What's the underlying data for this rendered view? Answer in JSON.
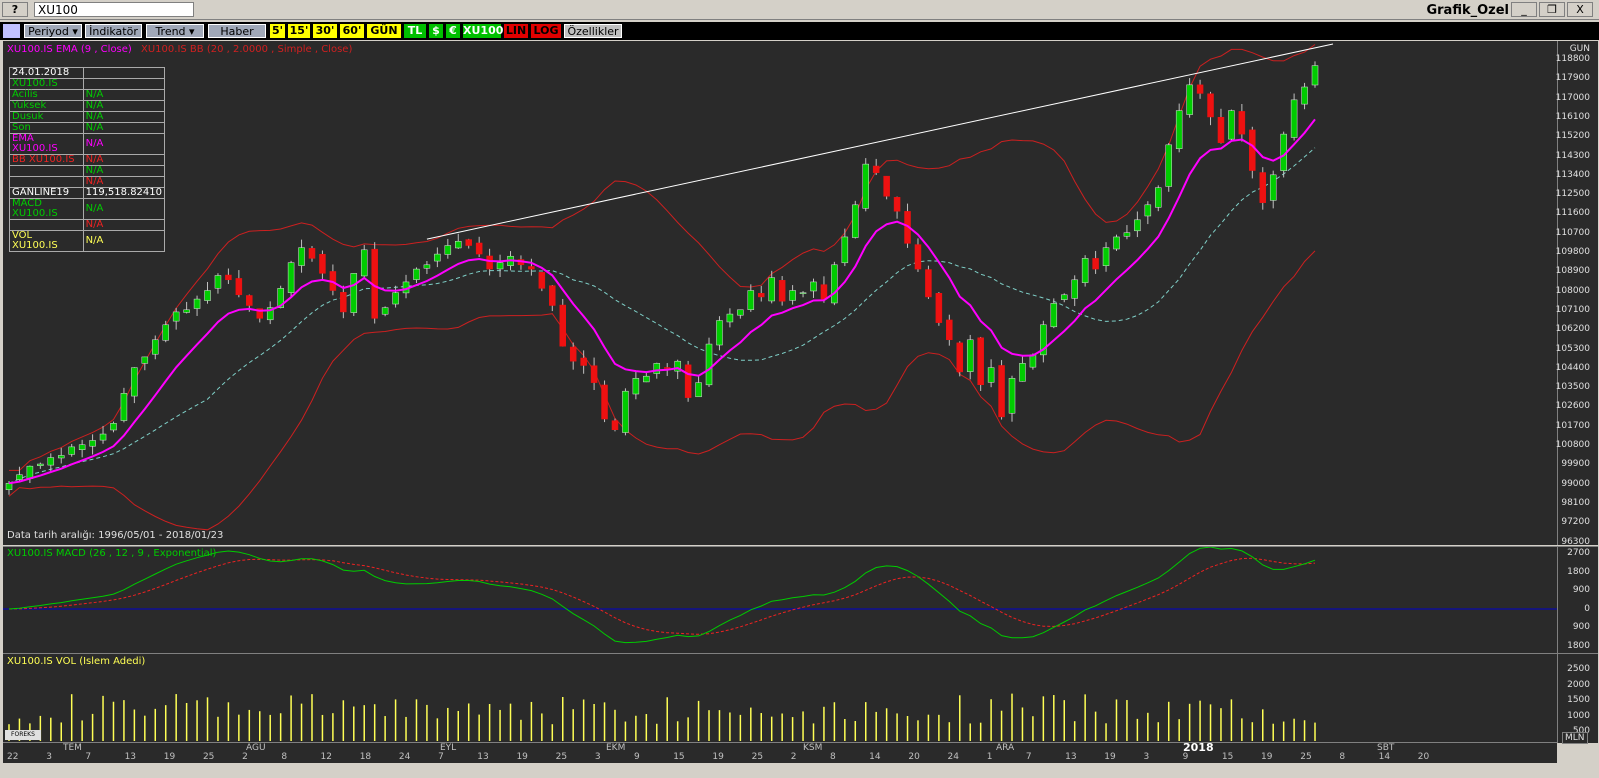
{
  "window": {
    "help": "?",
    "title": "XU100",
    "app_title": "Grafik_Ozel",
    "minimize": "_",
    "restore": "❐",
    "close": "X"
  },
  "toolbar": {
    "periyod": "Periyod ▾",
    "indikator": "İndikatör ▾",
    "trend": "Trend ▾",
    "haber": "Haber",
    "p5": "5'",
    "p15": "15'",
    "p30": "30'",
    "p60": "60'",
    "gun": "GÜN",
    "tl": "TL",
    "usd": "$",
    "eur": "€",
    "symbol": "XU100",
    "lin": "LIN",
    "log": "LOG",
    "ozellikler": "Özellikler"
  },
  "colors": {
    "bg": "#2a2a2a",
    "up": "#00cc00",
    "down": "#ee1111",
    "ema": "#ff00ff",
    "bb": "#cc2020",
    "dash": "#7fd0c8",
    "macd": "#00cc00",
    "signal": "#ee2222",
    "zero": "#0000cc",
    "vol": "#ffff55"
  },
  "main": {
    "legend_ema": "XU100.IS EMA (9 , Close)",
    "legend_bb": "XU100.IS BB (20 , 2.0000 , Simple , Close)",
    "period_label": "GUN",
    "date_range": "Data tarih aralığı: 1996/05/01 - 2018/01/23",
    "yticks": [
      "118800",
      "117900",
      "117000",
      "116100",
      "115200",
      "114300",
      "113400",
      "112500",
      "111600",
      "110700",
      "109800",
      "108900",
      "108000",
      "107100",
      "106200",
      "105300",
      "104400",
      "103500",
      "102600",
      "101700",
      "100800",
      "99900",
      "99000",
      "98100",
      "97200",
      "96300"
    ]
  },
  "info_table": [
    [
      "24.01.2018",
      ""
    ],
    [
      "XU100.IS",
      ""
    ],
    [
      "Acilis",
      "N/A"
    ],
    [
      "Yuksek",
      "N/A"
    ],
    [
      "Dusuk",
      "N/A"
    ],
    [
      "Son",
      "N/A"
    ],
    [
      "EMA XU100.IS",
      "N/A"
    ],
    [
      "BB XU100.IS",
      "N/A"
    ],
    [
      "",
      "N/A"
    ],
    [
      "",
      "N/A"
    ],
    [
      "GANLINE19",
      "119,518.82410"
    ],
    [
      "MACD XU100.IS",
      "N/A"
    ],
    [
      "",
      "N/A"
    ],
    [
      "VOL XU100.IS",
      "N/A"
    ]
  ],
  "macd": {
    "legend": "XU100.IS MACD (26 , 12 , 9 , Exponential)",
    "yticks": [
      "2700",
      "1800",
      "900",
      "0",
      "900",
      "1800"
    ]
  },
  "vol": {
    "legend": "XU100.IS VOL (Islem Adedi)",
    "yticks": [
      "2500",
      "2000",
      "1500",
      "1000",
      "500"
    ],
    "unit": "MLN",
    "logo": "FOREKS"
  },
  "xaxis": {
    "months": [
      "TEM",
      "AGU",
      "EYL",
      "EKM",
      "KSM",
      "ARA",
      "2018",
      "SBT"
    ],
    "days": [
      "22",
      "3",
      "7",
      "13",
      "19",
      "25",
      "2",
      "8",
      "12",
      "18",
      "24",
      "7",
      "13",
      "19",
      "25",
      "3",
      "9",
      "15",
      "19",
      "25",
      "2",
      "8",
      "14",
      "20",
      "24",
      "1",
      "7",
      "13",
      "19",
      "3",
      "9",
      "15",
      "19",
      "25",
      "8",
      "14",
      "20"
    ]
  },
  "chart_data": {
    "type": "candlestick",
    "title": "XU100",
    "ylim": [
      96300,
      118800
    ],
    "candles_close": [
      98900,
      99300,
      99700,
      99800,
      100100,
      100200,
      100600,
      100700,
      100900,
      101200,
      101700,
      103100,
      104300,
      104800,
      105600,
      106300,
      106900,
      107000,
      107500,
      107900,
      108600,
      108400,
      107700,
      107200,
      106600,
      107100,
      108000,
      109200,
      109900,
      109400,
      108700,
      107900,
      106900,
      108700,
      109800,
      106600,
      107100,
      107800,
      108300,
      108900,
      109100,
      109600,
      110000,
      110200,
      110000,
      109600,
      108900,
      109200,
      109500,
      109100,
      108900,
      108000,
      107200,
      105300,
      104600,
      104400,
      103600,
      101900,
      101400,
      103200,
      103800,
      103900,
      104500,
      104300,
      104600,
      102900,
      103600,
      105400,
      106500,
      106800,
      107000,
      107900,
      107600,
      108500,
      107400,
      107900,
      107800,
      108300,
      107500,
      109100,
      110400,
      111900,
      113800,
      113400,
      112300,
      111600,
      110100,
      108900,
      107600,
      106400,
      105600,
      104100,
      105600,
      103500,
      104300,
      102000,
      103800,
      104500,
      104900,
      106300,
      107300,
      107700,
      108400,
      109400,
      108900,
      109900,
      110400,
      110600,
      111200,
      111900,
      112700,
      114700,
      116300,
      117500,
      117100,
      116000,
      114800,
      116300,
      115200,
      113500,
      112000,
      113300,
      115200,
      116800,
      117400,
      118400
    ],
    "ema9_last": 115800,
    "bb_upper_last": 118700,
    "bb_lower_last": 111700,
    "macd_last": 1750,
    "signal_last": 1650
  }
}
